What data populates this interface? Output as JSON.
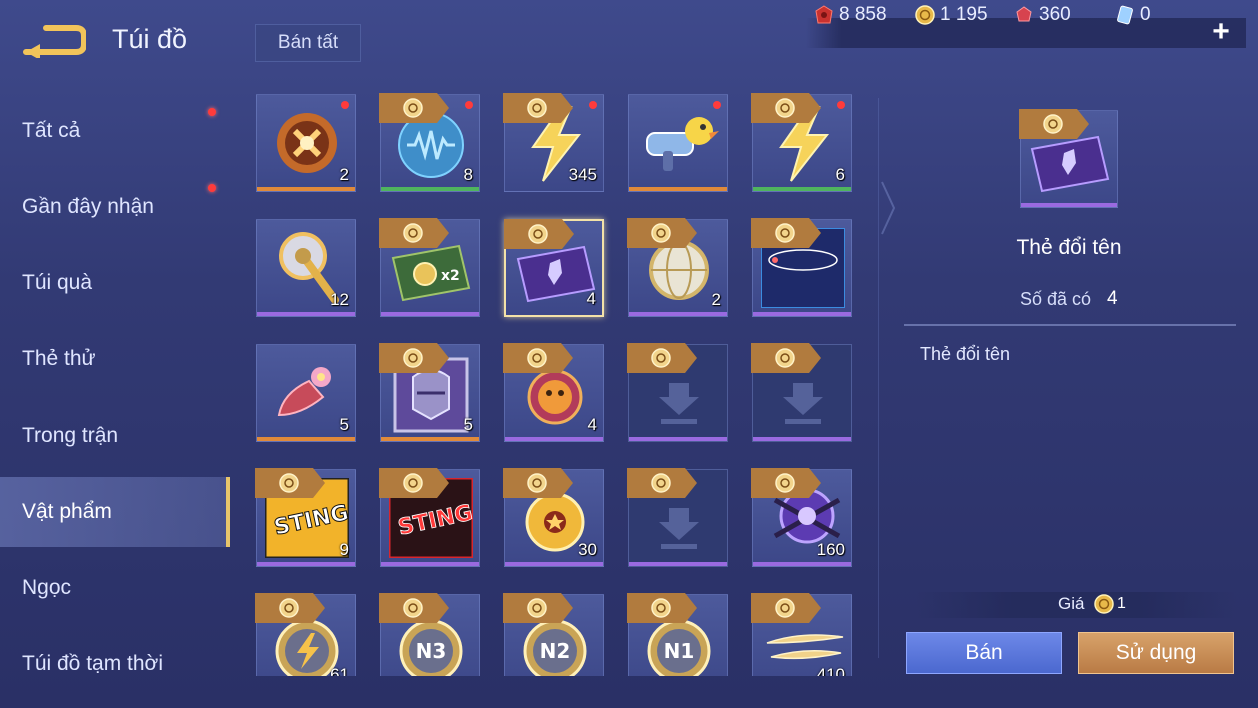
{
  "header": {
    "title": "Túi đồ",
    "sell_all": "Bán tất",
    "currencies": [
      {
        "icon": "red-voucher-icon",
        "value": "8 858"
      },
      {
        "icon": "gold-coin-icon",
        "value": "1 195"
      },
      {
        "icon": "red-gem-icon",
        "value": "360"
      },
      {
        "icon": "blue-card-icon",
        "value": "0"
      }
    ],
    "plus": "+"
  },
  "sidebar": {
    "items": [
      {
        "label": "Tất cả",
        "dot": true
      },
      {
        "label": "Gần đây nhận",
        "dot": true
      },
      {
        "label": "Túi quà",
        "dot": false
      },
      {
        "label": "Thẻ thử",
        "dot": false
      },
      {
        "label": "Trong trận",
        "dot": false
      },
      {
        "label": "Vật phẩm",
        "dot": false,
        "active": true
      },
      {
        "label": "Ngọc",
        "dot": false
      },
      {
        "label": "Túi đồ tạm thời",
        "dot": false
      }
    ]
  },
  "grid": {
    "rows": [
      [
        {
          "icon": "fiery-orb-icon",
          "count": "2",
          "rarity": "orange",
          "tag": false,
          "dot": true
        },
        {
          "icon": "blue-soundwave-orb-icon",
          "count": "8",
          "rarity": "green",
          "tag": true,
          "dot": true
        },
        {
          "icon": "lightning-bolt-icon",
          "count": "345",
          "rarity": "none",
          "tag": true,
          "dot": true
        },
        {
          "icon": "toy-blaster-icon",
          "count": "",
          "rarity": "orange",
          "tag": false,
          "dot": true
        },
        {
          "icon": "lightning-bolt-icon",
          "count": "6",
          "rarity": "green",
          "tag": true,
          "dot": true
        }
      ],
      [
        {
          "icon": "golden-scepter-icon",
          "count": "12",
          "rarity": "purple",
          "tag": false,
          "dot": false
        },
        {
          "icon": "coin-x2-card-icon",
          "count": "",
          "rarity": "purple",
          "tag": true,
          "dot": false
        },
        {
          "icon": "rename-card-icon",
          "count": "4",
          "rarity": "purple",
          "tag": true,
          "dot": false,
          "selected": true
        },
        {
          "icon": "silver-globe-icon",
          "count": "2",
          "rarity": "purple",
          "tag": true,
          "dot": false
        },
        {
          "icon": "mykolor-card-icon",
          "count": "",
          "rarity": "purple",
          "tag": true,
          "dot": false
        }
      ],
      [
        {
          "icon": "flower-horn-icon",
          "count": "5",
          "rarity": "orange",
          "tag": false,
          "dot": false
        },
        {
          "icon": "knight-helmet-icon",
          "count": "5",
          "rarity": "orange",
          "tag": true,
          "dot": false
        },
        {
          "icon": "pumpkin-badge-icon",
          "count": "4",
          "rarity": "purple",
          "tag": true,
          "dot": false
        },
        {
          "icon": "download-placeholder-icon",
          "count": "",
          "rarity": "purple",
          "tag": true,
          "dot": false
        },
        {
          "icon": "download-placeholder-icon",
          "count": "",
          "rarity": "purple",
          "tag": true,
          "dot": false
        }
      ],
      [
        {
          "icon": "sting-yellow-card-icon",
          "count": "9",
          "rarity": "purple",
          "tag": true,
          "dot": false
        },
        {
          "icon": "sting-red-card-icon",
          "count": "",
          "rarity": "purple",
          "tag": true,
          "dot": false
        },
        {
          "icon": "star-coin-icon",
          "count": "30",
          "rarity": "purple",
          "tag": true,
          "dot": false
        },
        {
          "icon": "download-placeholder-icon",
          "count": "",
          "rarity": "purple",
          "tag": true,
          "dot": false
        },
        {
          "icon": "purple-crossed-orb-icon",
          "count": "160",
          "rarity": "purple",
          "tag": true,
          "dot": false
        }
      ],
      [
        {
          "icon": "lightning-medal-icon",
          "count": "61",
          "rarity": "none",
          "tag": true,
          "dot": false
        },
        {
          "icon": "n3-medal-icon",
          "count": "",
          "rarity": "none",
          "tag": true,
          "dot": false,
          "label": "N3"
        },
        {
          "icon": "n2-medal-icon",
          "count": "",
          "rarity": "none",
          "tag": true,
          "dot": false,
          "label": "N2"
        },
        {
          "icon": "n1-medal-icon",
          "count": "",
          "rarity": "none",
          "tag": true,
          "dot": false,
          "label": "N1"
        },
        {
          "icon": "gold-feathers-icon",
          "count": "410",
          "rarity": "none",
          "tag": true,
          "dot": false
        }
      ]
    ]
  },
  "detail": {
    "name": "Thẻ đổi tên",
    "owned_label": "Số đã có",
    "owned_value": "4",
    "description": "Thẻ đổi tên",
    "price_label": "Giá",
    "price_value": "1",
    "sell_button": "Bán",
    "use_button": "Sử dụng"
  },
  "colors": {
    "accent_gold": "#e7c56b",
    "sell_blue": "#5b77dc",
    "use_orange": "#c98c55",
    "red_dot": "#ff3b3b"
  }
}
